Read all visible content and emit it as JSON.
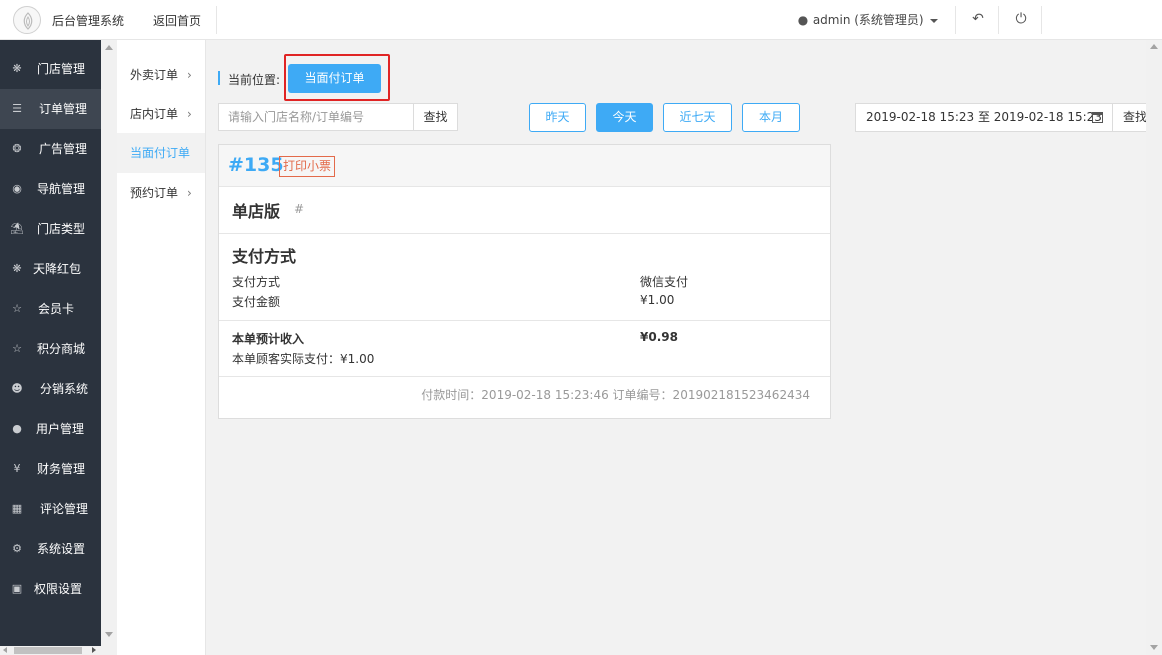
{
  "header": {
    "app_title": "后台管理系统",
    "home_link": "返回首页",
    "user_label": "admin (系统管理员)"
  },
  "sidebar": {
    "items": [
      {
        "label": "门店管理",
        "icon": "stores-icon"
      },
      {
        "label": "订单管理",
        "icon": "list-icon"
      },
      {
        "label": "广告管理",
        "icon": "lifebuoy-icon"
      },
      {
        "label": "导航管理",
        "icon": "compass-icon"
      },
      {
        "label": "门店类型",
        "icon": "bank-icon"
      },
      {
        "label": "天降红包",
        "icon": "cubes-icon"
      },
      {
        "label": "会员卡",
        "icon": "star-icon"
      },
      {
        "label": "积分商城",
        "icon": "star-icon"
      },
      {
        "label": "分销系统",
        "icon": "users-icon"
      },
      {
        "label": "用户管理",
        "icon": "user-icon"
      },
      {
        "label": "财务管理",
        "icon": "yen-icon"
      },
      {
        "label": "评论管理",
        "icon": "money-icon"
      },
      {
        "label": "系统设置",
        "icon": "gear-icon"
      },
      {
        "label": "权限设置",
        "icon": "lock-icon"
      }
    ],
    "active": "订单管理"
  },
  "subnav": {
    "items": [
      {
        "label": "外卖订单",
        "chevron": "›"
      },
      {
        "label": "店内订单",
        "chevron": "›"
      },
      {
        "label": "当面付订单",
        "chevron": ""
      },
      {
        "label": "预约订单",
        "chevron": "›"
      }
    ],
    "active": "当面付订单"
  },
  "breadcrumb": {
    "label": "当前位置:",
    "current": "当面付订单"
  },
  "search": {
    "placeholder": "请输入门店名称/订单编号",
    "button": "查找"
  },
  "date_filters": [
    {
      "label": "昨天",
      "active": false
    },
    {
      "label": "今天",
      "active": true
    },
    {
      "label": "近七天",
      "active": false
    },
    {
      "label": "本月",
      "active": false
    }
  ],
  "date_range": {
    "text": "2019-02-18 15:23 至 2019-02-18 15:23",
    "button": "查找"
  },
  "order": {
    "number": "#135",
    "print_label": "打印小票",
    "store_name": "单店版",
    "store_hash": "#",
    "payment_section_title": "支付方式",
    "payment_method_label": "支付方式",
    "payment_method_value": "微信支付",
    "payment_amount_label": "支付金额",
    "payment_amount_value": "¥1.00",
    "expected_income_label": "本单预计收入",
    "expected_income_value": "¥0.98",
    "customer_paid": "本单顾客实际支付：¥1.00",
    "footer": "付款时间：2019-02-18 15:23:46 订单编号：201902181523462434"
  },
  "colors": {
    "accent": "#3eaaf5",
    "sidebar_bg": "#2b333e",
    "highlight": "#e02424",
    "print_tag": "#e36a4a"
  }
}
